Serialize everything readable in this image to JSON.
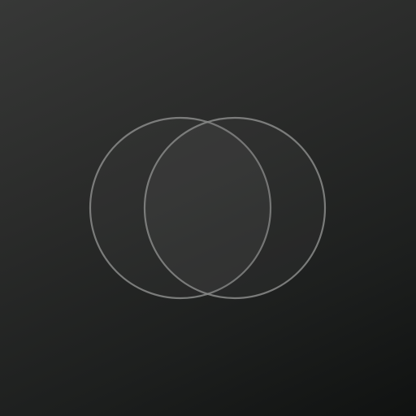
{
  "app": {
    "icon": "two-overlapping-circles-icon"
  },
  "colors": {
    "background_top": "#373837",
    "background_bottom": "#101211",
    "circle_stroke": "#8a8b8a",
    "circle_fill": "#5a5b5a"
  }
}
